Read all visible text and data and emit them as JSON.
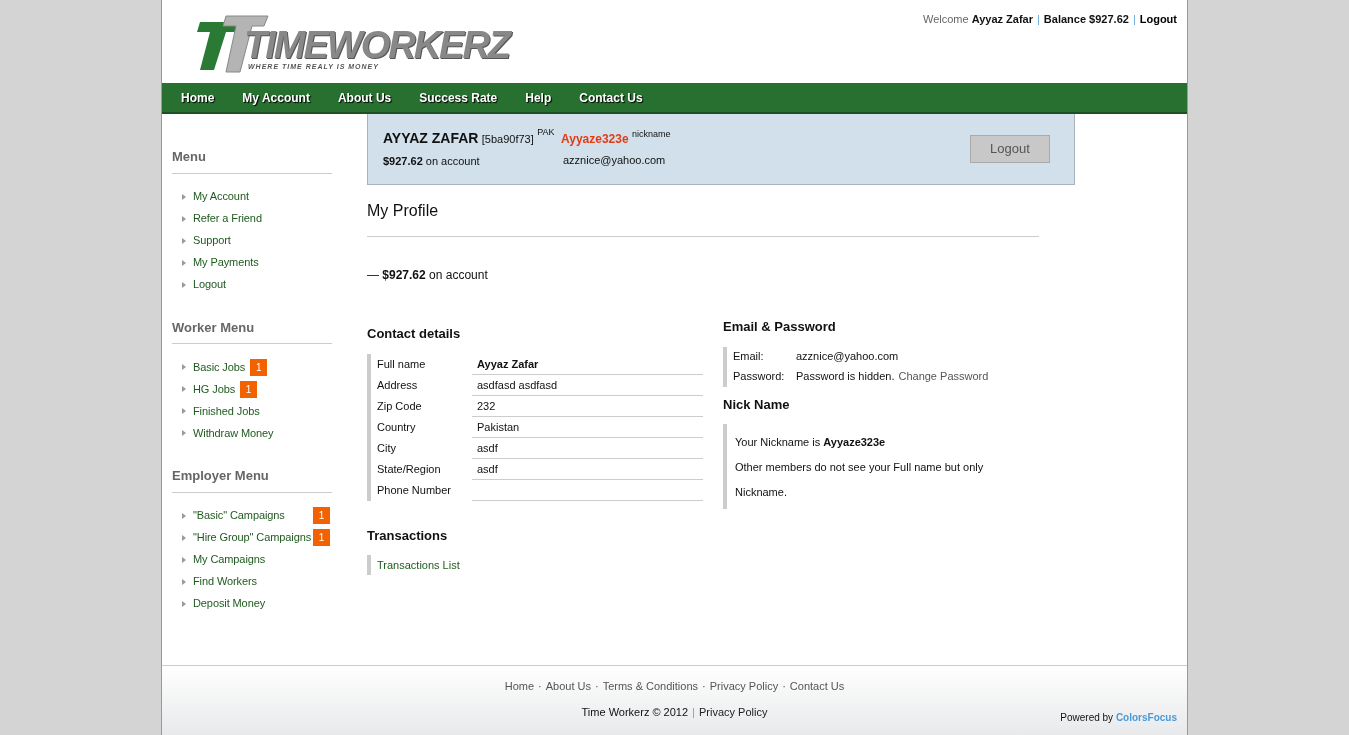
{
  "header": {
    "logo": {
      "text": "TIMEWORKERZ",
      "tagline": "WHERE TIME REALY IS MONEY"
    },
    "welcome": {
      "greeting": "Welcome",
      "user": "Ayyaz Zafar",
      "separator": "|",
      "balance": "Balance $927.62",
      "logout": "Logout"
    }
  },
  "nav": [
    {
      "label": "Home"
    },
    {
      "label": "My Account"
    },
    {
      "label": "About Us"
    },
    {
      "label": "Success Rate"
    },
    {
      "label": "Help"
    },
    {
      "label": "Contact Us"
    }
  ],
  "sidebar": [
    {
      "title": "Menu",
      "items": [
        {
          "label": "My Account"
        },
        {
          "label": "Refer a Friend"
        },
        {
          "label": "Support"
        },
        {
          "label": "My Payments"
        },
        {
          "label": "Logout"
        }
      ]
    },
    {
      "title": "Worker Menu",
      "items": [
        {
          "label": "Basic Jobs",
          "badge": "1"
        },
        {
          "label": "HG Jobs",
          "badge": "1"
        },
        {
          "label": "Finished Jobs"
        },
        {
          "label": "Withdraw Money"
        }
      ]
    },
    {
      "title": "Employer Menu",
      "items": [
        {
          "label": "\"Basic\" Campaigns",
          "badge": "1"
        },
        {
          "label": "\"Hire Group\" Campaigns",
          "badge": "1"
        },
        {
          "label": "My Campaigns"
        },
        {
          "label": "Find Workers"
        },
        {
          "label": "Deposit Money"
        }
      ]
    }
  ],
  "profile_bar": {
    "name": "AYYAZ ZAFAR",
    "id": "[5ba90f73]",
    "country": "PAK",
    "nickname": "Ayyaze323e",
    "nickname_label": "nickname",
    "balance": "$927.62",
    "balance_suffix": "on account",
    "email": "azznice@yahoo.com",
    "button": "Logout"
  },
  "page_title": "My Profile",
  "balance_line": "— **$927.62** on account",
  "contact": {
    "title": "Contact details",
    "rows": [
      {
        "label": "Full name",
        "value": "Ayyaz Zafar",
        "bold": true
      },
      {
        "label": "Address",
        "value": "asdfasd asdfasd",
        "bold": false
      },
      {
        "label": "Zip Code",
        "value": "232",
        "bold": false
      },
      {
        "label": "Country",
        "value": "Pakistan",
        "bold": false
      },
      {
        "label": "City",
        "value": "asdf",
        "bold": false
      },
      {
        "label": "State/Region",
        "value": "asdf",
        "bold": false
      },
      {
        "label": "Phone Number"
      }
    ]
  },
  "transactions": {
    "title": "Transactions",
    "link": "Transactions List"
  },
  "email_password": {
    "title": "Email & Password",
    "rows": [
      {
        "label": "Email:",
        "value": "azznice@yahoo.com"
      },
      {
        "label": "Password:",
        "value": "Password is hidden.",
        "link": "Change Password"
      }
    ]
  },
  "nickname": {
    "title": "Nick Name",
    "line": "Your Nickname is **Ayyaze323e**",
    "note": "Other members do not see your Full name but only Nickname."
  },
  "footer": {
    "links": [
      {
        "label": "Home"
      },
      {
        "label": "About Us"
      },
      {
        "label": "Terms & Conditions"
      },
      {
        "label": "Privacy Policy"
      },
      {
        "label": "Contact Us"
      }
    ],
    "separator": "·",
    "copyright": "Time Workerz © 2012",
    "divider": "|",
    "policy": "Privacy Policy",
    "powered": "Powered by",
    "powered_link": "ColorsFocus"
  }
}
